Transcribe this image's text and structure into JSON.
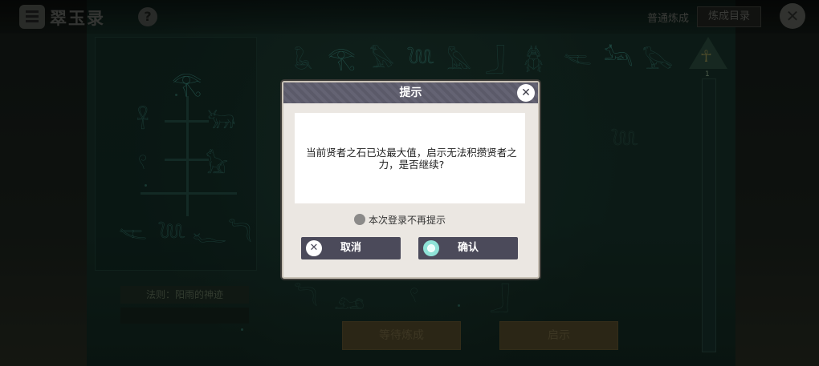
{
  "app": {
    "logo_text": "翠玉录",
    "help_symbol": "?",
    "top_label": "普通炼成",
    "top_tab": "炼成目录",
    "close_symbol": "✕"
  },
  "board": {
    "law_label": "法则：阳雨的神迹",
    "left_button": "等待炼成",
    "right_button": "启示",
    "ankh_symbol": "☥",
    "ankh_count": "1",
    "glyph_row": [
      "𓆘",
      "𓂀",
      "𓅃",
      "𓆙",
      "𓅓",
      "𓃀",
      "𓆣",
      "𓌻",
      "𓃢",
      "𓅂"
    ],
    "tree_glyphs": [
      "𓂀",
      "𓋹",
      "𓃒",
      "𓍢",
      "𓃠",
      "𓌻",
      "𓆙",
      "𓆑",
      "𓆓"
    ],
    "mid_glyphs": [
      "𓆓",
      "𓃭",
      "𓍢",
      "𓃀",
      "𓆙"
    ]
  },
  "dialog": {
    "title": "提示",
    "close_symbol": "✕",
    "message": "当前贤者之石已达最大值，启示无法积攒贤者之力，是否继续?",
    "checkbox_label": "本次登录不再提示",
    "cancel_label": "取消",
    "cancel_icon": "✕",
    "confirm_label": "确认"
  }
}
